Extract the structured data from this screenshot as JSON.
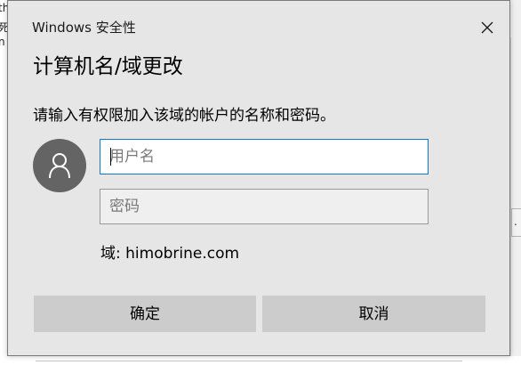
{
  "background": {
    "left_fragments": [
      "therm",
      "死",
      "n"
    ],
    "right_fragment": "."
  },
  "dialog": {
    "window_title": "Windows 安全性",
    "close_icon": "close-icon",
    "heading": "计算机名/域更改",
    "instruction": "请输入有权限加入该域的帐户的名称和密码。",
    "avatar_icon": "user-icon",
    "username": {
      "value": "",
      "placeholder": "用户名"
    },
    "password": {
      "value": "",
      "placeholder": "密码"
    },
    "domain_text": "域: himobrine.com",
    "ok_label": "确定",
    "cancel_label": "取消"
  },
  "colors": {
    "dialog_bg": "#e6e6e6",
    "focus_border": "#0b78d4",
    "button_bg": "#cccccc",
    "avatar_bg": "#646464"
  }
}
